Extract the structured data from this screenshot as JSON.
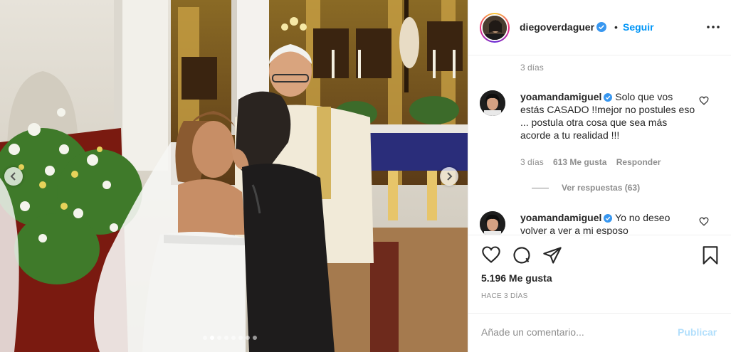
{
  "post": {
    "author": "diegoverdaguer",
    "verified": true,
    "separator": "•",
    "follow_label": "Seguir",
    "caption_time": "3 días",
    "likes_text": "5.196 Me gusta",
    "posted_ago": "HACE 3 DÍAS",
    "carousel": {
      "slide_count": 8,
      "active_index": 1
    }
  },
  "comments": [
    {
      "username": "yoamandamiguel",
      "verified": true,
      "text": "Solo que vos estás CASADO !!mejor no postules eso ... postula otra cosa que sea más acorde a tu realidad !!!",
      "time": "3 días",
      "likes": "613 Me gusta",
      "reply_label": "Responder",
      "view_replies": "Ver respuestas (63)"
    },
    {
      "username": "yoamandamiguel",
      "verified": true,
      "text": "Yo no deseo volver a ver a mi esposo"
    }
  ],
  "composer": {
    "placeholder": "Añade un comentario...",
    "publish_label": "Publicar"
  },
  "icons": {
    "like": "heart-icon",
    "comment": "comment-icon",
    "share": "paper-plane-icon",
    "save": "bookmark-icon",
    "more": "ellipsis-icon",
    "verified": "verified-badge-icon",
    "prev": "chevron-left-icon",
    "next": "chevron-right-icon"
  },
  "colors": {
    "link": "#0095f6",
    "publish_disabled": "#b2dffc",
    "secondary_text": "#8e8e8e",
    "verified": "#3897f0"
  }
}
